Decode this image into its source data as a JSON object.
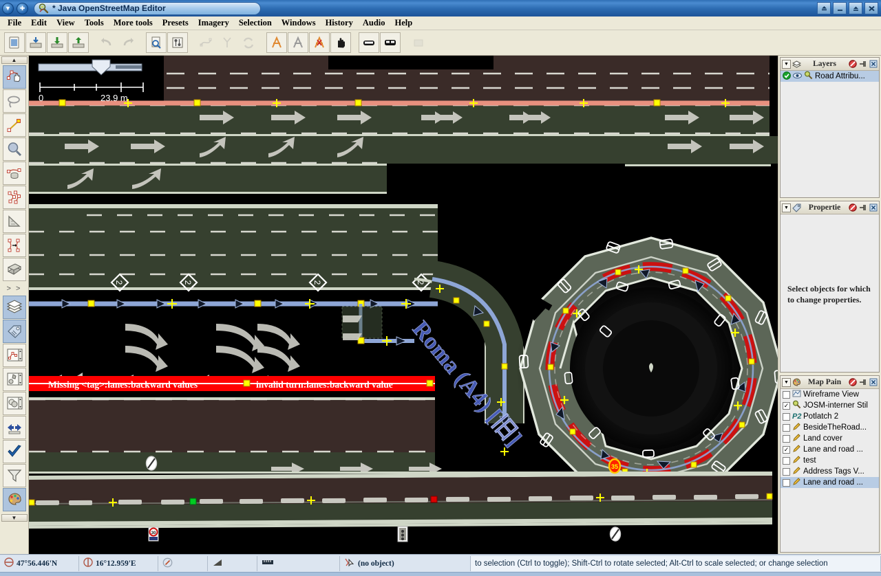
{
  "window": {
    "title": "* Java OpenStreetMap Editor",
    "app_icon": "josm-logo-icon",
    "collapse_label": "▼",
    "expand_label": "✚",
    "controls": [
      {
        "name": "shade-button",
        "glyph": "⬆"
      },
      {
        "name": "minimize-button",
        "glyph": "–"
      },
      {
        "name": "maximize-button",
        "glyph": "▲"
      },
      {
        "name": "close-button",
        "glyph": "✕"
      }
    ]
  },
  "menubar": {
    "items": [
      {
        "label": "File"
      },
      {
        "label": "Edit"
      },
      {
        "label": "View"
      },
      {
        "label": "Tools"
      },
      {
        "label": "More tools"
      },
      {
        "label": "Presets"
      },
      {
        "label": "Imagery"
      },
      {
        "label": "Selection"
      },
      {
        "label": "Windows"
      },
      {
        "label": "History"
      },
      {
        "label": "Audio"
      },
      {
        "label": "Help"
      }
    ]
  },
  "toolbar": {
    "buttons": [
      {
        "name": "new-layer-button",
        "icon": "new-document-icon",
        "disabled": false
      },
      {
        "name": "open-file-button",
        "icon": "open-folder-icon",
        "disabled": false
      },
      {
        "name": "download-data-button",
        "icon": "download-arrow-icon",
        "disabled": false
      },
      {
        "name": "upload-data-button",
        "icon": "upload-arrow-icon",
        "disabled": false
      },
      {
        "name": "undo-button",
        "icon": "undo-arrow-icon",
        "disabled": true
      },
      {
        "name": "redo-button",
        "icon": "redo-arrow-icon",
        "disabled": true
      },
      {
        "name": "search-button",
        "icon": "search-document-icon",
        "disabled": false
      },
      {
        "name": "preferences-button",
        "icon": "preferences-icon",
        "disabled": false
      },
      {
        "name": "split-way-button",
        "icon": "split-way-icon",
        "disabled": true
      },
      {
        "name": "combine-way-button",
        "icon": "combine-way-icon",
        "disabled": true
      },
      {
        "name": "reverse-way-button",
        "icon": "reverse-way-icon",
        "disabled": true
      },
      {
        "name": "lane-tool-a-button",
        "icon": "road-lanes-orange-icon",
        "disabled": false
      },
      {
        "name": "lane-tool-b-button",
        "icon": "road-lanes-grey-icon",
        "disabled": false
      },
      {
        "name": "lane-tool-c-button",
        "icon": "road-lanes-red-icon",
        "disabled": false
      },
      {
        "name": "pan-hand-button",
        "icon": "hand-icon",
        "disabled": false
      },
      {
        "name": "car-profile-button",
        "icon": "car-icon",
        "disabled": false
      },
      {
        "name": "bus-profile-button",
        "icon": "bus-icon",
        "disabled": false
      },
      {
        "name": "misc-button",
        "icon": "grey-tool-icon",
        "disabled": true
      }
    ]
  },
  "toolrail": {
    "top_arrow": "▲",
    "bottom_arrow": "▼",
    "overflow": "> >",
    "tools": [
      {
        "name": "select-tool",
        "icon": "select-hand-icon",
        "selected": true
      },
      {
        "name": "lasso-tool",
        "icon": "lasso-icon",
        "selected": false
      },
      {
        "name": "draw-nodes-tool",
        "icon": "draw-line-icon",
        "selected": false
      },
      {
        "name": "zoom-tool",
        "icon": "magnifier-icon",
        "selected": false
      },
      {
        "name": "delete-tool",
        "icon": "delete-trash-icon",
        "selected": false
      },
      {
        "name": "parallel-way-tool",
        "icon": "parallel-ways-icon",
        "selected": false
      },
      {
        "name": "extrude-tool",
        "icon": "triangle-ruler-icon",
        "selected": false
      },
      {
        "name": "improve-way-accuracy-tool",
        "icon": "improve-way-icon",
        "selected": false
      },
      {
        "name": "building-tool",
        "icon": "building-block-icon",
        "selected": false
      }
    ],
    "dialogs": [
      {
        "name": "layers-dialog-toggle",
        "icon": "layers-stack-icon",
        "selected": true
      },
      {
        "name": "properties-dialog-toggle",
        "icon": "tag-label-icon",
        "selected": true
      },
      {
        "name": "selection-dialog-toggle",
        "icon": "selection-list-icon",
        "selected": false
      },
      {
        "name": "relations-dialog-toggle",
        "icon": "relation-icon",
        "selected": false
      },
      {
        "name": "history-dialog-toggle",
        "icon": "history-stack-icon",
        "selected": false
      },
      {
        "name": "conflict-dialog-toggle",
        "icon": "conflict-arrows-icon",
        "selected": false
      },
      {
        "name": "validator-dialog-toggle",
        "icon": "checkmark-icon",
        "selected": false
      },
      {
        "name": "filter-dialog-toggle",
        "icon": "funnel-filter-icon",
        "selected": false
      },
      {
        "name": "map-paint-dialog-toggle",
        "icon": "paint-palette-icon",
        "selected": true
      }
    ]
  },
  "map": {
    "scalebar": {
      "min_label": "0",
      "max_label": "23.9 m"
    },
    "labels": {
      "road_name": "Roma (A4) [旧]",
      "error_left": "Missing <tag>:lanes:backward values",
      "error_right": "invalid turn:lanes:backward value",
      "lane_marker": "2",
      "speed_sign": "30",
      "circle_sign": "35"
    },
    "colors": {
      "background": "#000000",
      "road_fill": "#36402f",
      "road_fill_brown": "#3a2b28",
      "casing": "#cfd6c6",
      "selected_way": "#8ea6d6",
      "error_red": "#ff0000",
      "node_yellow": "#ffff00",
      "highlight_salmon": "#e8907f",
      "node_green": "#00cc00",
      "node_red": "#dd0000",
      "roundabout_fill": "#5c6657"
    }
  },
  "dock": {
    "layers_panel": {
      "title": "Layers",
      "icon": "layers-stack-icon",
      "menu_glyph": "▼",
      "header_icons": [
        {
          "name": "delete-layer-icon",
          "glyph": "⛔"
        },
        {
          "name": "pin-dialog-icon",
          "glyph": "⚐"
        },
        {
          "name": "close-dialog-icon",
          "glyph": "✕"
        }
      ],
      "items": [
        {
          "name": "layer-road-attributes",
          "label": "Road Attribu...",
          "active_icon": "green-check-icon",
          "visible_icon": "eye-icon",
          "type_icon": "osm-data-layer-icon",
          "selected": true
        }
      ]
    },
    "properties_panel": {
      "title": "Propertie",
      "icon": "tag-label-icon",
      "menu_glyph": "▼",
      "header_icons": [
        {
          "name": "delete-tag-icon",
          "glyph": "⛔"
        },
        {
          "name": "pin-dialog-icon",
          "glyph": "⚐"
        },
        {
          "name": "close-dialog-icon",
          "glyph": "✕"
        }
      ],
      "empty_message": "Select objects for which to change properties."
    },
    "map_paint_panel": {
      "title": "Map Pain",
      "icon": "paint-palette-icon",
      "menu_glyph": "▼",
      "header_icons": [
        {
          "name": "delete-style-icon",
          "glyph": "⛔"
        },
        {
          "name": "pin-dialog-icon",
          "glyph": "⚐"
        },
        {
          "name": "close-dialog-icon",
          "glyph": "✕"
        }
      ],
      "styles": [
        {
          "name": "style-wireframe-view",
          "label": "Wireframe View",
          "checked": false,
          "icon": "wireframe-icon",
          "selected": false
        },
        {
          "name": "style-josm-internal",
          "label": "JOSM-interner Stil",
          "checked": true,
          "icon": "josm-logo-icon",
          "selected": false
        },
        {
          "name": "style-potlatch-2",
          "label": "Potlatch 2",
          "checked": false,
          "icon": "p2-badge-icon",
          "selected": false
        },
        {
          "name": "style-besidetheroad",
          "label": "BesideTheRoad...",
          "checked": false,
          "icon": "pencil-icon",
          "selected": false
        },
        {
          "name": "style-land-cover",
          "label": "Land cover",
          "checked": false,
          "icon": "pencil-icon",
          "selected": false
        },
        {
          "name": "style-lane-and-road-1",
          "label": "Lane and road ...",
          "checked": true,
          "icon": "pencil-icon",
          "selected": false
        },
        {
          "name": "style-test",
          "label": "test",
          "checked": false,
          "icon": "pencil-icon",
          "selected": false
        },
        {
          "name": "style-address-tags",
          "label": "Address Tags V...",
          "checked": false,
          "icon": "pencil-icon",
          "selected": false
        },
        {
          "name": "style-lane-and-road-2",
          "label": "Lane and road ...",
          "checked": false,
          "icon": "pencil-icon",
          "selected": true
        }
      ]
    }
  },
  "statusbar": {
    "latitude": "47°56.446'N",
    "longitude": "16°12.959'E",
    "heading": "",
    "angle": "",
    "distance": "",
    "object": "(no object)",
    "help_text": "to selection (Ctrl to toggle); Shift-Ctrl to rotate selected; Alt-Ctrl to scale selected; or change selection",
    "icons": {
      "lat": "latitude-circle-icon",
      "lon": "longitude-circle-icon",
      "heading": "heading-dial-icon",
      "angle": "angle-icon",
      "dist": "ruler-icon",
      "object": "cursor-object-icon"
    }
  }
}
